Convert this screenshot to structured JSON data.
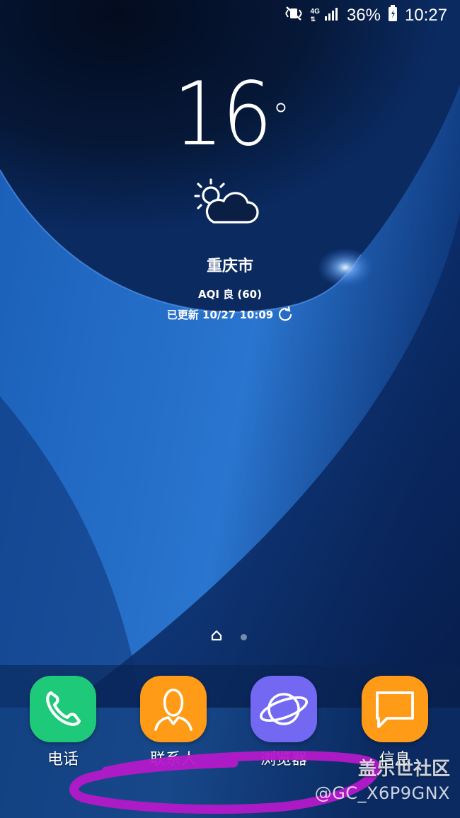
{
  "status_bar": {
    "network": "4G",
    "battery_percent": "36%",
    "time": "10:27",
    "icons": [
      "vibrate-icon",
      "signal-icon",
      "battery-icon"
    ]
  },
  "weather": {
    "temperature": "16",
    "degree_symbol": "°",
    "condition_icon": "partly-cloudy-icon",
    "city": "重庆市",
    "aqi": "AQI 良 (60)",
    "updated": "已更新 10/27 10:09"
  },
  "pager": {
    "current_page": 1,
    "page_count": 2
  },
  "dock": {
    "apps": [
      {
        "label": "电话",
        "icon": "phone-icon",
        "color": "#1ec97a"
      },
      {
        "label": "联系人",
        "icon": "contacts-icon",
        "color": "#ff9b17"
      },
      {
        "label": "浏览器",
        "icon": "browser-icon",
        "color": "#7368f2"
      },
      {
        "label": "信息",
        "icon": "message-icon",
        "color": "#ff9b17"
      }
    ]
  },
  "watermark": {
    "title": "盖乐世社区",
    "user": "@GC_X6P9GNX"
  },
  "colors": {
    "wallpaper_dark": "#06142e",
    "wallpaper_blue": "#1a54a8",
    "scribble": "#b419c9"
  }
}
